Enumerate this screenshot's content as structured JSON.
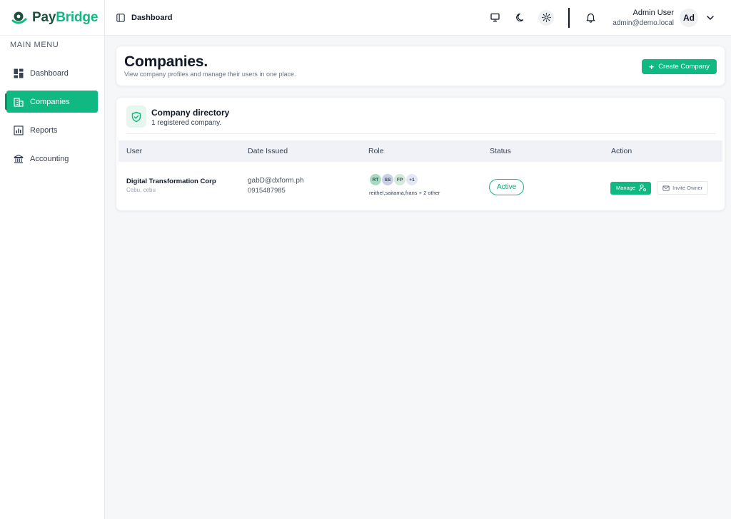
{
  "brand": {
    "part1": "Pay",
    "part2": "Bridge"
  },
  "sidebar": {
    "heading": "MAIN MENU",
    "items": [
      {
        "label": "Dashboard",
        "icon": "dashboard-grid-icon"
      },
      {
        "label": "Companies",
        "icon": "building-icon",
        "active": true
      },
      {
        "label": "Reports",
        "icon": "bar-chart-icon"
      },
      {
        "label": "Accounting",
        "icon": "bank-icon"
      }
    ]
  },
  "topbar": {
    "breadcrumb": "Dashboard",
    "theme_buttons": [
      "monitor-icon",
      "moon-icon",
      "sun-icon"
    ],
    "user": {
      "name": "Admin User",
      "email": "admin@demo.local",
      "initials": "Ad"
    }
  },
  "header": {
    "title": "Companies.",
    "subtitle": "View company profiles and manage their users in one place.",
    "create_label": "Create Company"
  },
  "directory": {
    "title": "Company directory",
    "subtitle": "1 registered company.",
    "columns": [
      "User",
      "Date Issued",
      "Role",
      "Status",
      "Action"
    ],
    "rows": [
      {
        "company": "Digital Transformation Corp",
        "location": "Cebu, cebu",
        "email": "gabD@dxform.ph",
        "phone": "0915487985",
        "avatars": [
          "RT",
          "SS",
          "FP",
          "+1"
        ],
        "role_names": "reithel,saitama,frans + 2 other",
        "status": "Active",
        "manage_label": "Manage",
        "invite_label": "Invite Owner"
      }
    ]
  },
  "colors": {
    "accent": "#10b981",
    "brand_dark": "#1f4f3f",
    "avatar_rt": "#a7dcc3",
    "avatar_ss": "#c9cfe4",
    "avatar_fp": "#d4ead9",
    "avatar_more": "#e3e6f3"
  }
}
